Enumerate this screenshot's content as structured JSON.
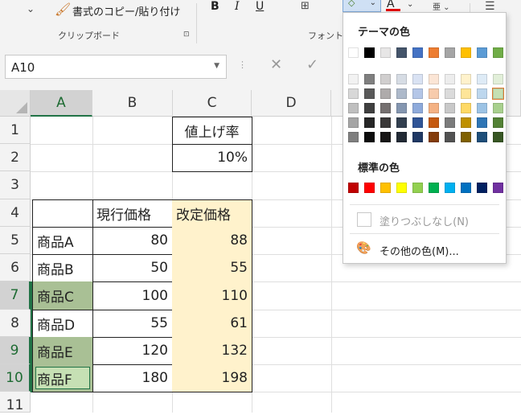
{
  "ribbon": {
    "clipboard": {
      "chevron": "⌄",
      "format_painter_icon": "paintbrush-icon",
      "format_painter_label": "書式のコピー/貼り付け",
      "group_label": "クリップボード",
      "launcher": "⊡"
    },
    "font": {
      "group_label": "フォント",
      "bold": "B",
      "italic": "I",
      "underline": "U",
      "font_color_glyph": "A",
      "font_color": "#e00000",
      "fill_color": "#4a7c2a"
    }
  },
  "formula_bar": {
    "name_box": "A10",
    "dots": "⋮",
    "cancel": "✕",
    "enter": "✓"
  },
  "sheet": {
    "columns": [
      "A",
      "B",
      "C",
      "D"
    ],
    "rows": [
      "1",
      "2",
      "3",
      "4",
      "5",
      "6",
      "7",
      "8",
      "9",
      "10",
      "11"
    ],
    "selected_rows": [
      "7",
      "9",
      "10"
    ],
    "cells": {
      "C1": "値上げ率",
      "C2": "10%",
      "B4": "現行価格",
      "C4": "改定価格",
      "A5": "商品A",
      "B5": "80",
      "C5": "88",
      "A6": "商品B",
      "B6": "50",
      "C6": "55",
      "A7": "商品C",
      "B7": "100",
      "C7": "110",
      "A8": "商品D",
      "B8": "55",
      "C8": "61",
      "A9": "商品E",
      "B9": "120",
      "C9": "132",
      "A10": "商品F",
      "B10": "180",
      "C10": "198"
    },
    "fill_colors": {
      "price_column": "#fff2cc",
      "selected_fill": "#a9c095",
      "active_fill": "#c6e0b4"
    }
  },
  "color_menu": {
    "theme_title": "テーマの色",
    "theme_top_row": [
      "#ffffff",
      "#000000",
      "#e7e6e6",
      "#44546a",
      "#4472c4",
      "#ed7d31",
      "#a5a5a5",
      "#ffc000",
      "#5b9bd5",
      "#70ad47"
    ],
    "theme_shades": [
      [
        "#f2f2f2",
        "#7f7f7f",
        "#d0cece",
        "#d6dce4",
        "#d9e2f3",
        "#fbe5d5",
        "#ededed",
        "#fff2cc",
        "#deebf6",
        "#e2efd9"
      ],
      [
        "#d8d8d8",
        "#595959",
        "#aeabab",
        "#adb9ca",
        "#b4c6e7",
        "#f7cbac",
        "#dbdbdb",
        "#fee599",
        "#bdd7ee",
        "#c5e0b3"
      ],
      [
        "#bfbfbf",
        "#3f3f3f",
        "#757070",
        "#8496b0",
        "#8eaadb",
        "#f4b183",
        "#c9c9c9",
        "#ffd965",
        "#9cc3e5",
        "#a8d08d"
      ],
      [
        "#a5a5a5",
        "#262626",
        "#3a3838",
        "#323f4f",
        "#2f5496",
        "#c55a11",
        "#7b7b7b",
        "#bf9000",
        "#2e75b5",
        "#538135"
      ],
      [
        "#7f7f7f",
        "#0c0c0c",
        "#171616",
        "#222a35",
        "#1f3864",
        "#833c0b",
        "#525252",
        "#7f6000",
        "#1e4e79",
        "#375623"
      ]
    ],
    "standard_title": "標準の色",
    "standard_colors": [
      "#c00000",
      "#ff0000",
      "#ffc000",
      "#ffff00",
      "#92d050",
      "#00b050",
      "#00b0f0",
      "#0070c0",
      "#002060",
      "#7030a0"
    ],
    "no_fill": "塗りつぶしなし(N)",
    "more_colors": "その他の色(M)...",
    "more_colors_icon": "palette-icon"
  }
}
